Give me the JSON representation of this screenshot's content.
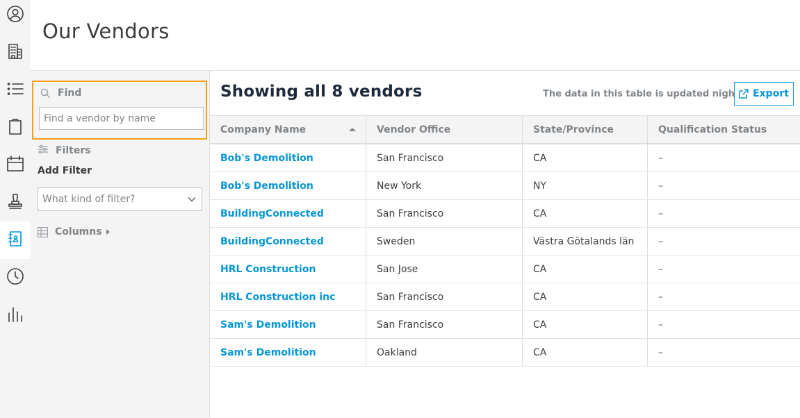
{
  "rail": [
    {
      "name": "user-circle-icon"
    },
    {
      "name": "buildings-icon"
    },
    {
      "name": "list-icon"
    },
    {
      "name": "clipboard-icon"
    },
    {
      "name": "calendar-icon"
    },
    {
      "name": "stamp-icon"
    },
    {
      "name": "address-book-icon",
      "active": true
    },
    {
      "name": "clock-icon"
    },
    {
      "name": "bar-chart-icon"
    }
  ],
  "page": {
    "title": "Our Vendors"
  },
  "panel": {
    "find_label": "Find",
    "find_placeholder": "Find a vendor by name",
    "find_value": "",
    "filters_label": "Filters",
    "add_filter_label": "Add Filter",
    "filter_select_placeholder": "What kind of filter?",
    "columns_label": "Columns"
  },
  "content": {
    "title": "Showing all 8 vendors",
    "note": "The data in this table is updated nightly",
    "export_label": "Export"
  },
  "table": {
    "columns": [
      "Company Name",
      "Vendor Office",
      "State/Province",
      "Qualification Status"
    ],
    "sort": {
      "column": "Company Name",
      "direction": "ascending"
    },
    "rows": [
      [
        "Bob's Demolition",
        "San Francisco",
        "CA",
        "–"
      ],
      [
        "Bob's Demolition",
        "New York",
        "NY",
        "–"
      ],
      [
        "BuildingConnected",
        "San Francisco",
        "CA",
        "–"
      ],
      [
        "BuildingConnected",
        "Sweden",
        "Västra Götalands län",
        "–"
      ],
      [
        "HRL Construction",
        "San Jose",
        "CA",
        "–"
      ],
      [
        "HRL Construction inc",
        "San Francisco",
        "CA",
        "–"
      ],
      [
        "Sam's Demolition",
        "San Francisco",
        "CA",
        "–"
      ],
      [
        "Sam's Demolition",
        "Oakland",
        "CA",
        "–"
      ]
    ]
  },
  "colors": {
    "accent": "#0696d7",
    "highlight": "#fa9d1c",
    "panel_bg": "#f4f4f4",
    "muted_text": "#80858a"
  }
}
